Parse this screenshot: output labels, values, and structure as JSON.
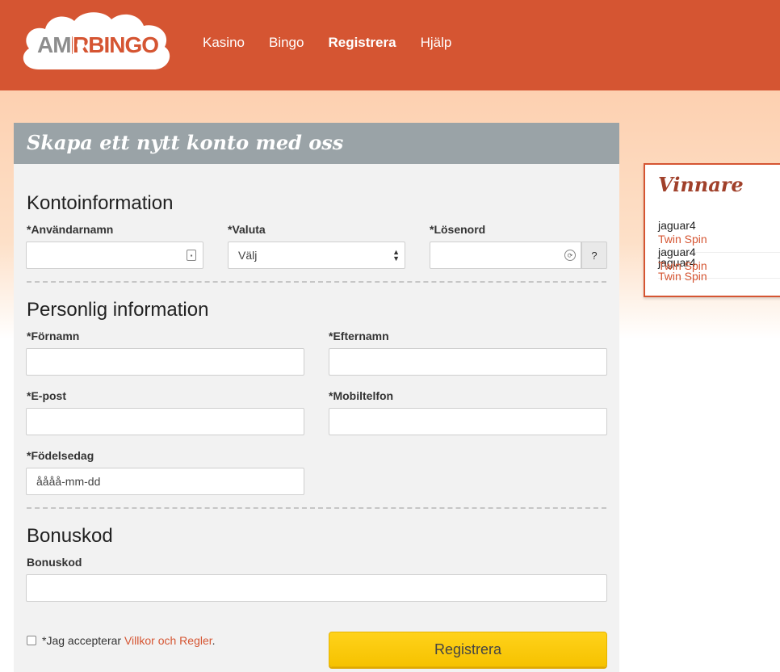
{
  "header": {
    "logo_text_left": "AM",
    "logo_text_right": "RBINGO",
    "nav": [
      {
        "label": "Kasino",
        "active": false
      },
      {
        "label": "Bingo",
        "active": false
      },
      {
        "label": "Registrera",
        "active": true
      },
      {
        "label": "Hjälp",
        "active": false
      }
    ]
  },
  "form": {
    "title": "Skapa ett nytt konto med oss",
    "account": {
      "heading": "Kontoinformation",
      "username_label": "*Användarnamn",
      "currency_label": "*Valuta",
      "currency_value": "Välj",
      "password_label": "*Lösenord",
      "help_label": "?"
    },
    "personal": {
      "heading": "Personlig information",
      "first_name_label": "*Förnamn",
      "last_name_label": "*Efternamn",
      "email_label": "*E-post",
      "mobile_label": "*Mobiltelfon",
      "birthday_label": "*Födelsedag",
      "birthday_placeholder": "åååå-mm-dd"
    },
    "bonus": {
      "heading": "Bonuskod",
      "code_label": "Bonuskod"
    },
    "accept_prefix": "*Jag accepterar ",
    "accept_link": "Villkor och Regler",
    "accept_suffix": ".",
    "submit_label": "Registrera"
  },
  "winners": {
    "title": "Vinnare",
    "entries": [
      {
        "user": "jaguar4",
        "game": "Twin Spin"
      },
      {
        "user": "jaguar4",
        "game": "Twin Spin"
      },
      {
        "user": "jaguar4",
        "game": "Twin Spin"
      }
    ]
  },
  "colors": {
    "brand": "#d55532",
    "header_gray": "#9aa3a7",
    "button_yellow": "#ffd21a"
  }
}
